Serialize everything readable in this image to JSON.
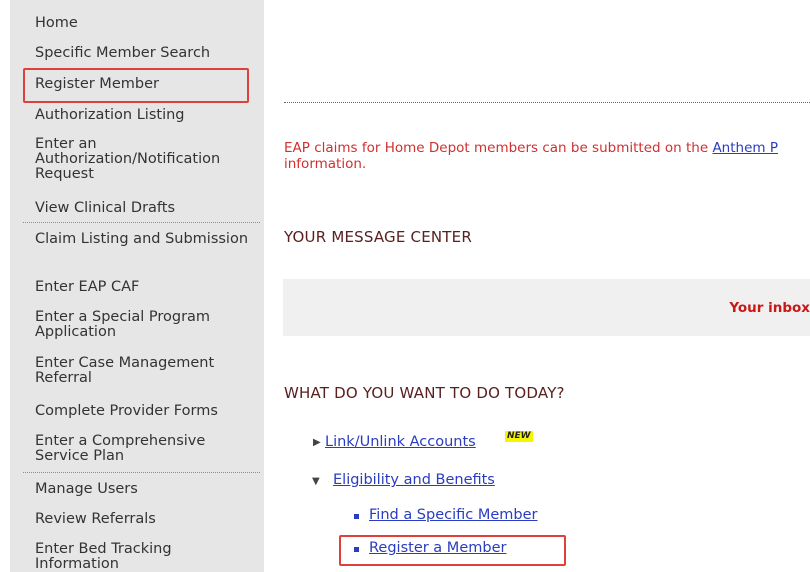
{
  "sidebar": {
    "items": [
      {
        "label": "Home"
      },
      {
        "label": "Specific Member Search"
      },
      {
        "label": "Register Member"
      },
      {
        "label": "Authorization Listing"
      },
      {
        "label": "Enter an Authorization/Notification Request"
      },
      {
        "label": "View Clinical Drafts"
      },
      {
        "label": "Claim Listing and Submission"
      },
      {
        "label": "Enter EAP CAF"
      },
      {
        "label": "Enter a Special Program Application"
      },
      {
        "label": "Enter Case Management Referral"
      },
      {
        "label": "Complete Provider Forms"
      },
      {
        "label": "Enter a Comprehensive Service Plan"
      },
      {
        "label": "Manage Users"
      },
      {
        "label": "Review Referrals"
      },
      {
        "label": "Enter Bed Tracking Information"
      }
    ]
  },
  "notice": {
    "text_before": "EAP claims for Home Depot members can be submitted on the ",
    "link": "Anthem P",
    "text_line2": "information."
  },
  "message_center": {
    "title": "YOUR MESSAGE CENTER",
    "inbox_text": "Your inbox"
  },
  "todo": {
    "title": "WHAT DO YOU WANT TO DO TODAY?",
    "link_unlink": "Link/Unlink Accounts",
    "new_badge": "NEW",
    "eligibility": "Eligibility and Benefits",
    "find_member": "Find a Specific Member",
    "register_member": "Register a Member"
  },
  "colors": {
    "highlight": "#e0403c",
    "link": "#2a3cc0",
    "notice": "#d03030",
    "sidebar_bg": "#e6e6e6"
  }
}
